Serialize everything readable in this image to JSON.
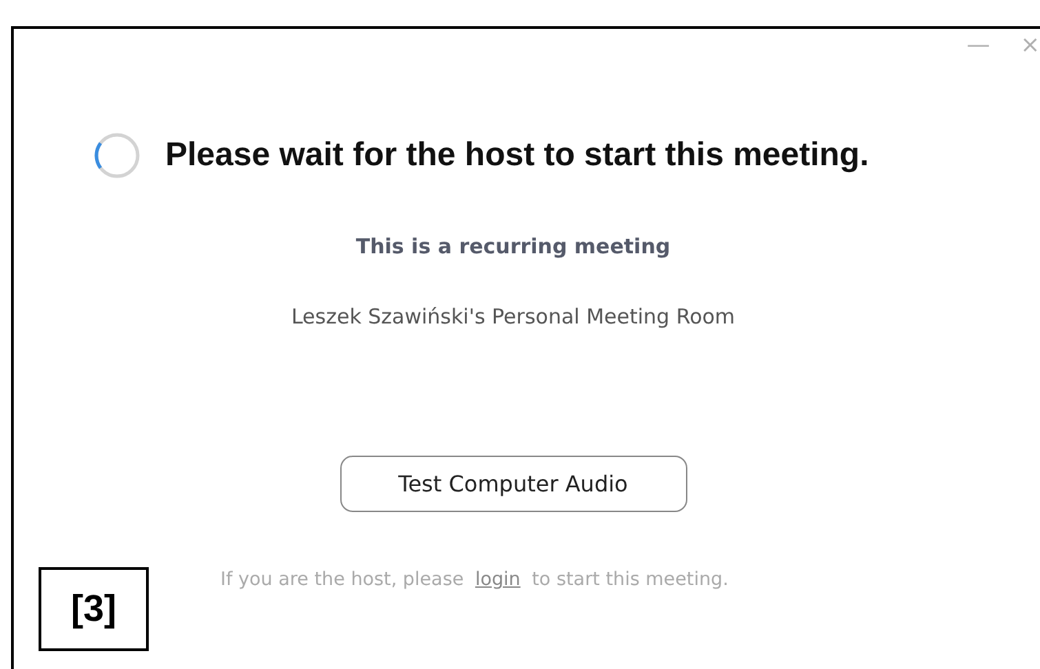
{
  "window": {
    "controls": [
      "—",
      "×"
    ]
  },
  "heading": "Please wait for the host to start this meeting.",
  "subtitle": "This is a recurring meeting",
  "room_name": "Leszek Szawiński's Personal Meeting Room",
  "button": "Test Computer Audio",
  "footer": {
    "before": "If you are the host, please",
    "link": "login",
    "after": "to start this meeting."
  },
  "annotation": "[3]"
}
